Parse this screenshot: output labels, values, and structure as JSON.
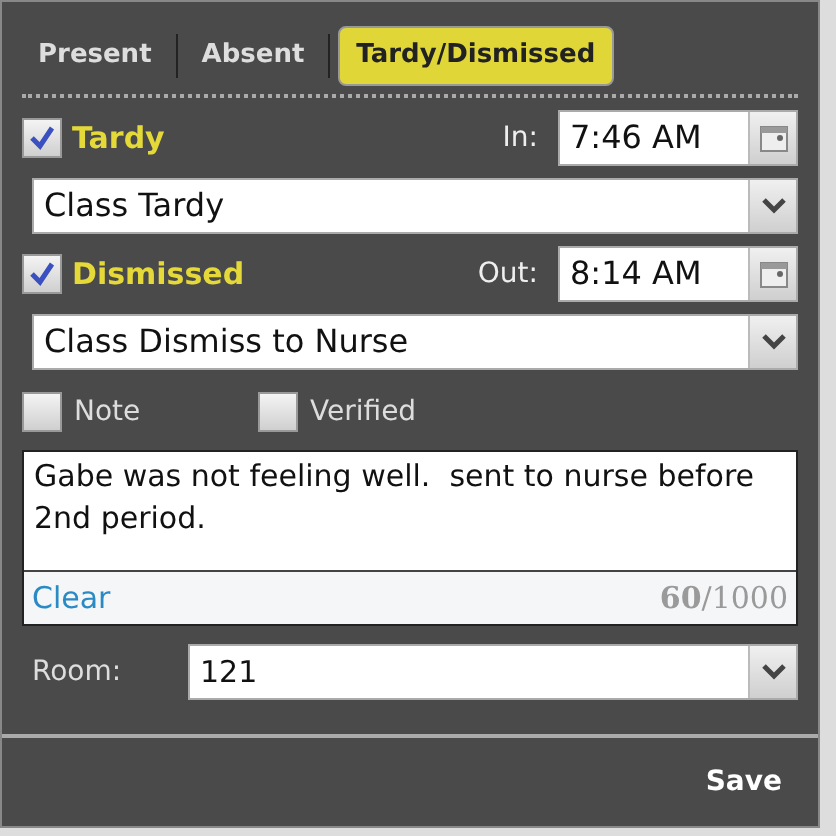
{
  "tabs": [
    {
      "label": "Present",
      "selected": false
    },
    {
      "label": "Absent",
      "selected": false
    },
    {
      "label": "Tardy/Dismissed",
      "selected": true
    }
  ],
  "tardy": {
    "label": "Tardy",
    "checked": true,
    "time_label": "In:",
    "time": "7:46 AM",
    "reason": "Class Tardy"
  },
  "dismissed": {
    "label": "Dismissed",
    "checked": true,
    "time_label": "Out:",
    "time": "8:14 AM",
    "reason": "Class Dismiss to Nurse"
  },
  "options": [
    {
      "label": "Note",
      "checked": false
    },
    {
      "label": "Verified",
      "checked": false
    }
  ],
  "comment": {
    "value": "Gabe was not feeling well.  sent to nurse before 2nd period.",
    "clear": "Clear",
    "counter": "**60**/1000"
  },
  "room": {
    "label": "Room:",
    "value": "121"
  },
  "save": "Save"
}
